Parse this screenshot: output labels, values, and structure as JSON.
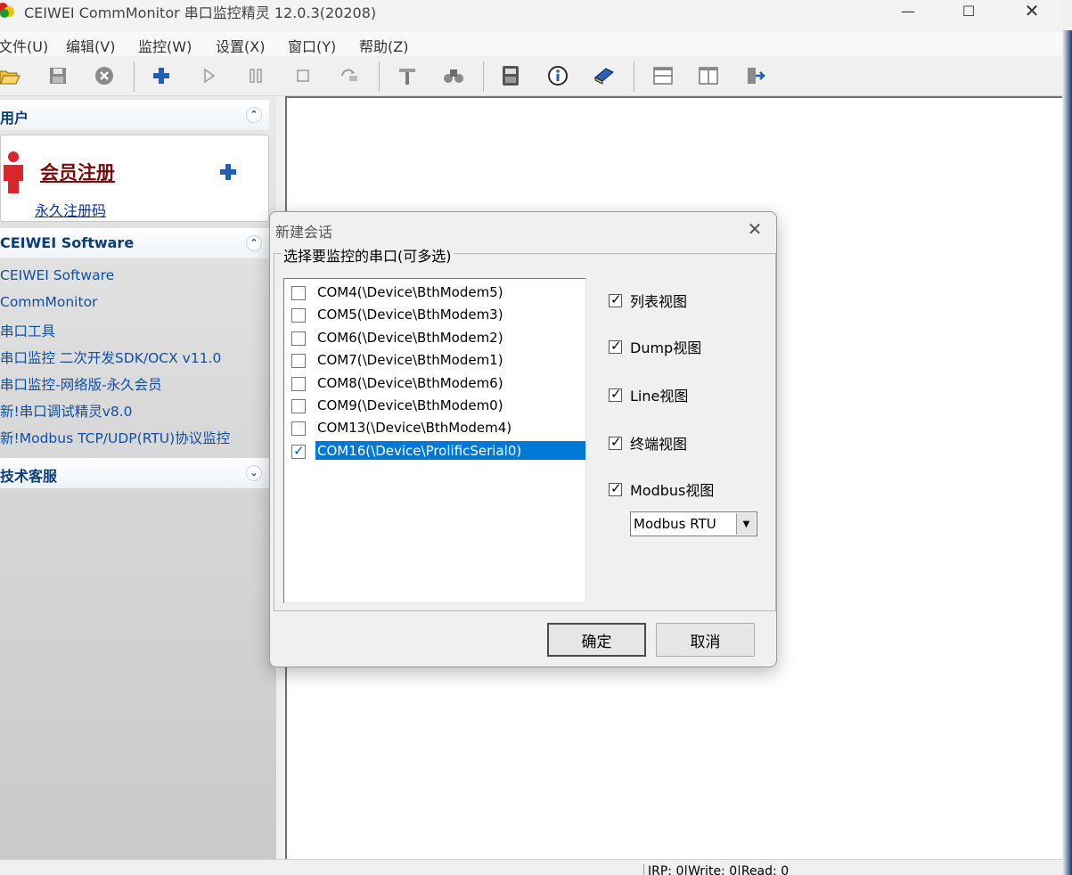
{
  "window": {
    "title": "CEIWEI CommMonitor 串口监控精灵 12.0.3(20208)"
  },
  "menu": [
    "文件(U)",
    "编辑(V)",
    "监控(W)",
    "设置(X)",
    "窗口(Y)",
    "帮助(Z)"
  ],
  "toolbar": [
    "open-folder-icon",
    "save-icon",
    "stop-circle-icon",
    "add-icon",
    "play-icon",
    "pause-icon",
    "stop-icon",
    "reconnect-icon",
    "tools-icon",
    "find-icon",
    "calculator-icon",
    "info-icon",
    "book-icon",
    "split-horizontal-icon",
    "split-vertical-icon",
    "exit-icon"
  ],
  "sidebar": {
    "user_panel": {
      "title": "用户",
      "register_label": "会员注册",
      "permanent_code_label": "永久注册码"
    },
    "software_panel": {
      "title": "CEIWEI Software",
      "links": [
        "CEIWEI Software",
        "CommMonitor",
        "串口工具",
        "串口监控 二次开发SDK/OCX v11.0",
        "串口监控-网络版-永久会员",
        "新!串口调试精灵v8.0",
        "新!Modbus TCP/UDP(RTU)协议监控"
      ]
    },
    "support_panel": {
      "title": "技术客服"
    }
  },
  "dialog": {
    "title": "新建会话",
    "group_label": "选择要监控的串口(可多选)",
    "ports": [
      {
        "label": "COM4(\\Device\\BthModem5)",
        "checked": false,
        "selected": false
      },
      {
        "label": "COM5(\\Device\\BthModem3)",
        "checked": false,
        "selected": false
      },
      {
        "label": "COM6(\\Device\\BthModem2)",
        "checked": false,
        "selected": false
      },
      {
        "label": "COM7(\\Device\\BthModem1)",
        "checked": false,
        "selected": false
      },
      {
        "label": "COM8(\\Device\\BthModem6)",
        "checked": false,
        "selected": false
      },
      {
        "label": "COM9(\\Device\\BthModem0)",
        "checked": false,
        "selected": false
      },
      {
        "label": "COM13(\\Device\\BthModem4)",
        "checked": false,
        "selected": false
      },
      {
        "label": "COM16(\\Device\\ProlificSerial0)",
        "checked": true,
        "selected": true
      }
    ],
    "views": [
      {
        "label": "列表视图",
        "checked": true
      },
      {
        "label": "Dump视图",
        "checked": true
      },
      {
        "label": "Line视图",
        "checked": true
      },
      {
        "label": "终端视图",
        "checked": true
      },
      {
        "label": "Modbus视图",
        "checked": true
      }
    ],
    "modbus_mode": "Modbus RTU",
    "ok_label": "确定",
    "cancel_label": "取消"
  },
  "statusbar": {
    "text": "IRP: 0|Write: 0|Read: 0"
  }
}
